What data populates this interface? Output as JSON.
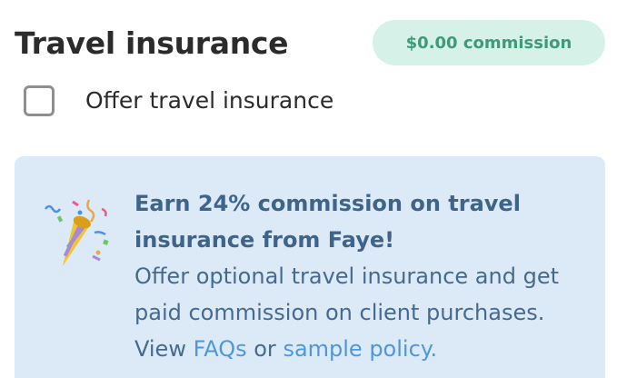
{
  "section": {
    "title": "Travel insurance",
    "commission_badge": "$0.00 commission"
  },
  "option": {
    "label": "Offer travel insurance",
    "checked": false
  },
  "info_box": {
    "icon": "party-popper-icon",
    "heading": "Earn 24% commission on travel insurance from Faye!",
    "body": "Offer optional travel insurance and get paid commission on client purchases.",
    "view_prefix": "View",
    "faqs_link": "FAQs",
    "or_text": "or",
    "sample_policy_link": "sample policy."
  },
  "colors": {
    "badge_bg": "#d6f1e7",
    "badge_text": "#3f9a78",
    "info_bg": "#dce9f6",
    "info_text": "#3f6489",
    "link": "#4d97dd"
  }
}
